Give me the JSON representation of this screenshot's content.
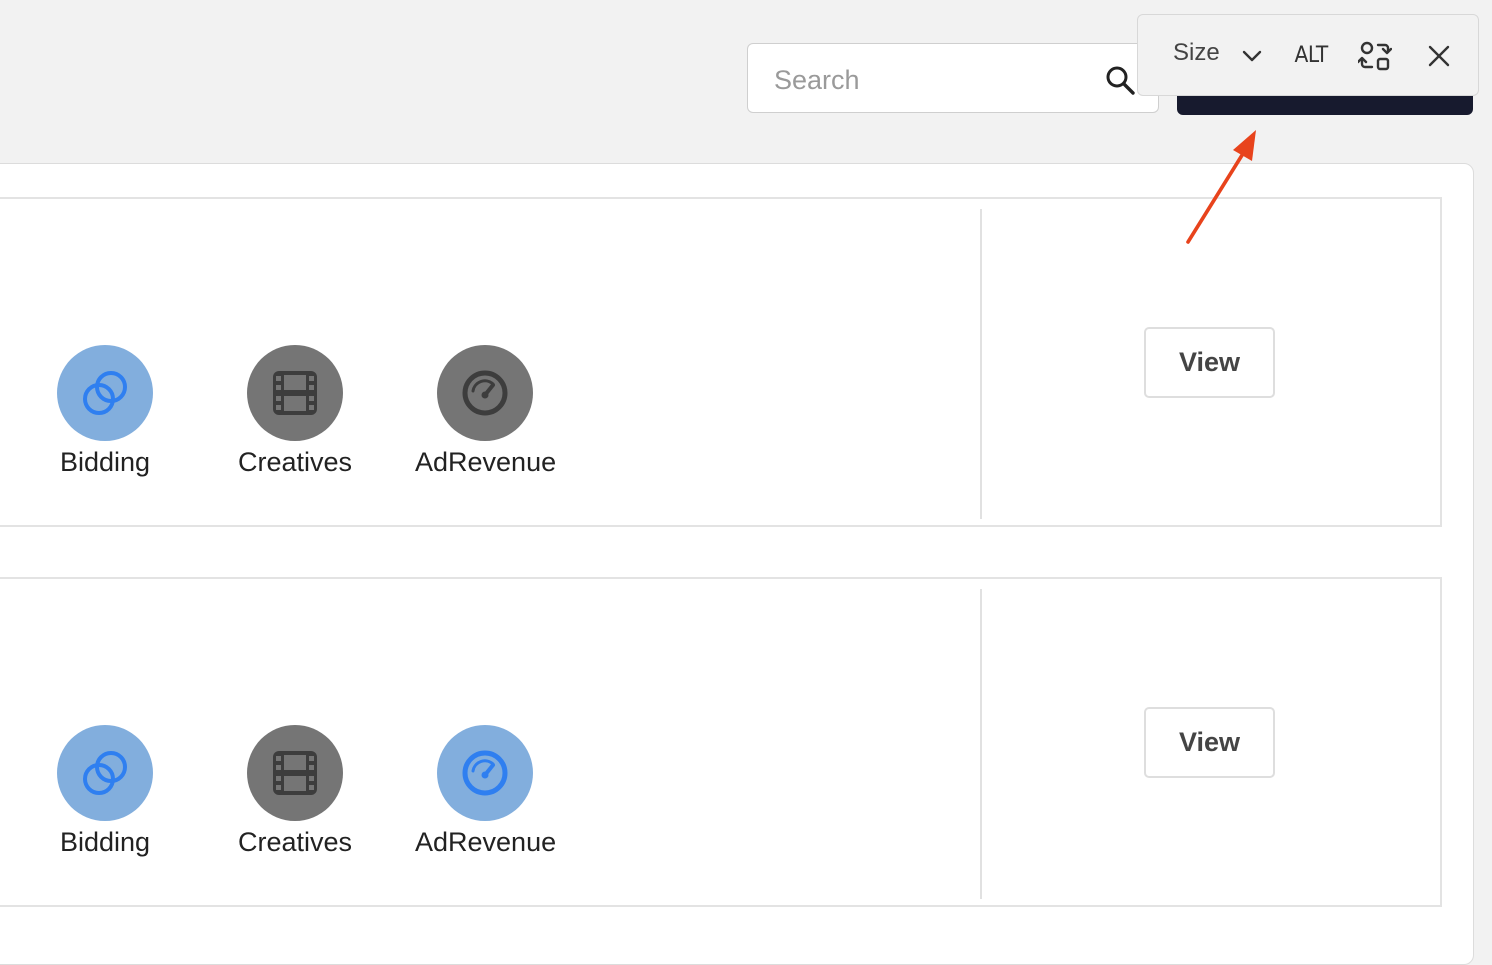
{
  "search": {
    "placeholder": "Search"
  },
  "image_toolbar": {
    "size_label": "Size",
    "alt_label": "ALT"
  },
  "cards": [
    {
      "modules": [
        {
          "label": "Bidding",
          "state": "active",
          "icon": "overlapping-circles-icon"
        },
        {
          "label": "Creatives",
          "state": "inactive",
          "icon": "film-icon"
        },
        {
          "label": "AdRevenue",
          "state": "inactive",
          "icon": "speedometer-icon"
        }
      ],
      "view_label": "View"
    },
    {
      "modules": [
        {
          "label": "Bidding",
          "state": "active",
          "icon": "overlapping-circles-icon"
        },
        {
          "label": "Creatives",
          "state": "inactive",
          "icon": "film-icon"
        },
        {
          "label": "AdRevenue",
          "state": "active",
          "icon": "speedometer-icon"
        }
      ],
      "view_label": "View"
    }
  ],
  "colors": {
    "active_circle": "#82aedd",
    "active_icon": "#2f7ff0",
    "inactive_circle": "#757575",
    "inactive_icon": "#3d3d3d",
    "dark_button": "#171a2e",
    "annotation_arrow": "#e8431c"
  }
}
